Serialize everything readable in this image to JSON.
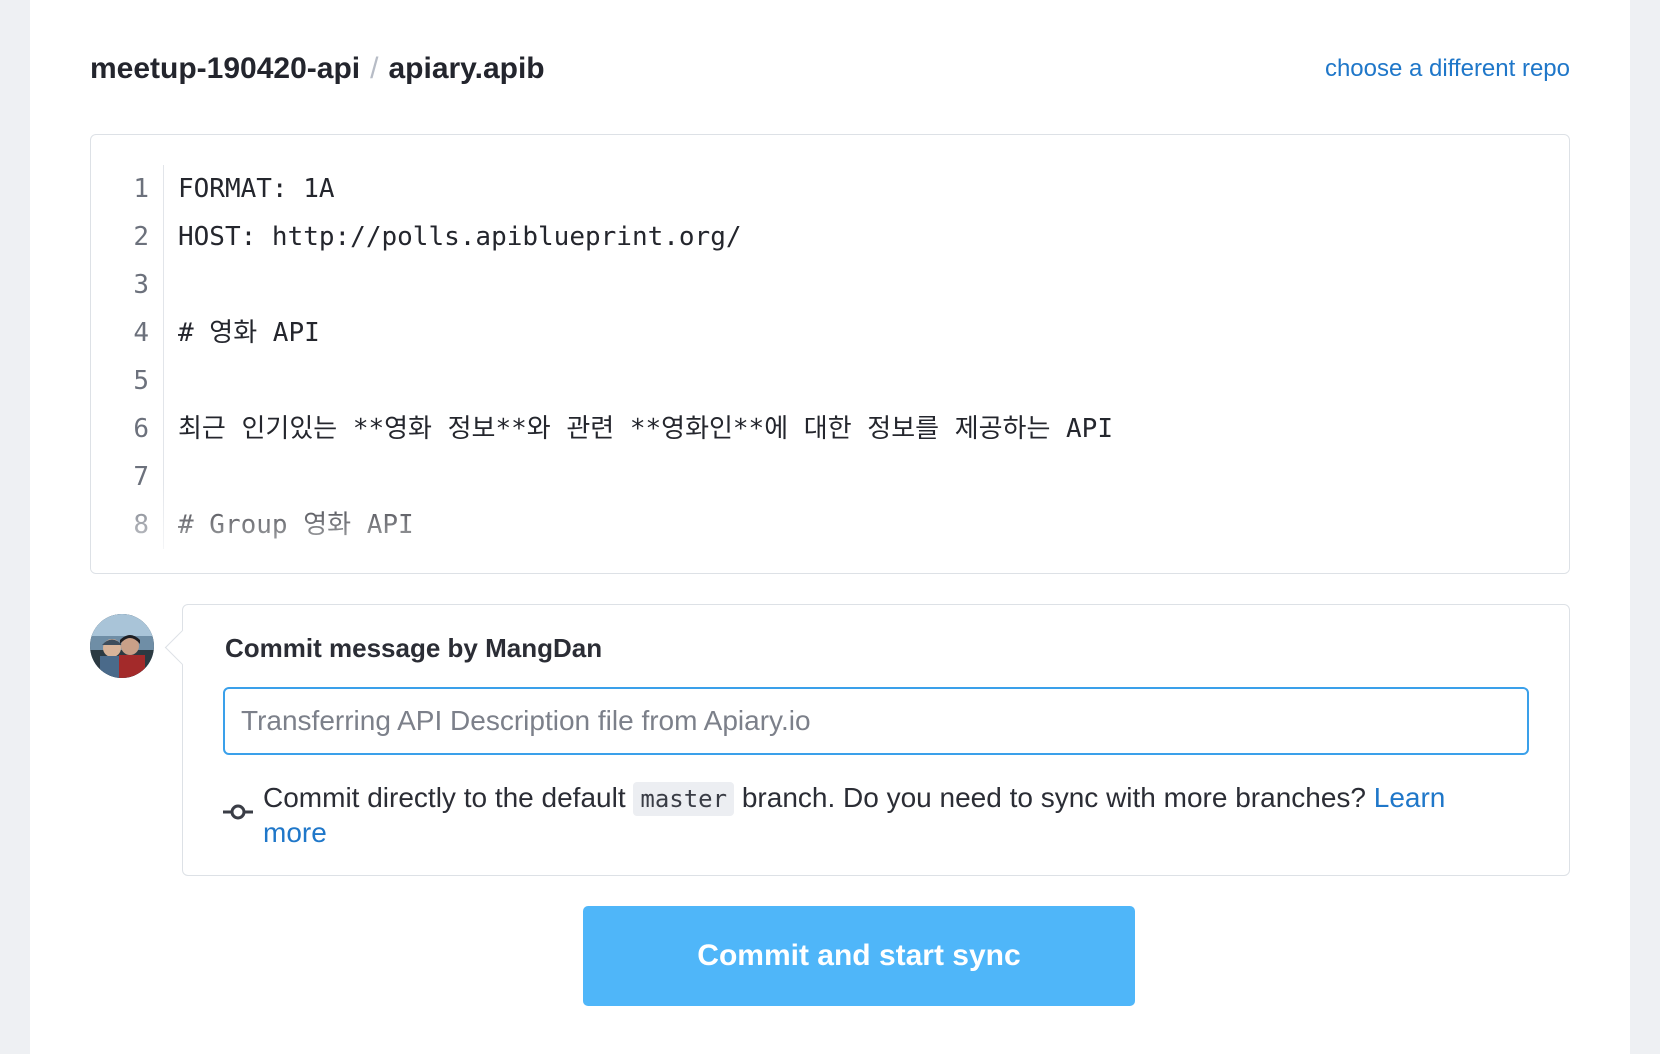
{
  "header": {
    "repo_name": "meetup-190420-api",
    "separator": "/",
    "file_name": "apiary.apib",
    "change_repo_link": "choose a different repo"
  },
  "editor": {
    "lines": [
      {
        "num": "1",
        "text": "FORMAT: 1A"
      },
      {
        "num": "2",
        "text": "HOST: http://polls.apiblueprint.org/"
      },
      {
        "num": "3",
        "text": ""
      },
      {
        "num": "4",
        "text": "# 영화 API"
      },
      {
        "num": "5",
        "text": ""
      },
      {
        "num": "6",
        "text": "최근 인기있는 **영화 정보**와 관련 **영화인**에 대한 정보를 제공하는 API"
      },
      {
        "num": "7",
        "text": ""
      },
      {
        "num": "8",
        "text": "# Group 영화 API"
      }
    ]
  },
  "commit": {
    "title": "Commit message by MangDan",
    "placeholder": "Transferring API Description file from Apiary.io",
    "value": "",
    "branch_text_before": "Commit directly to the default",
    "branch_name": "master",
    "branch_text_after": "branch. Do you need to sync with more branches?",
    "learn_more_link": "Learn more"
  },
  "button": {
    "label": "Commit and start sync"
  },
  "icons": {
    "branch": "git-commit-icon",
    "avatar": "user-avatar"
  },
  "colors": {
    "accent": "#1f77c9",
    "button": "#4fb6f9",
    "input_focus": "#3aa0ea"
  }
}
